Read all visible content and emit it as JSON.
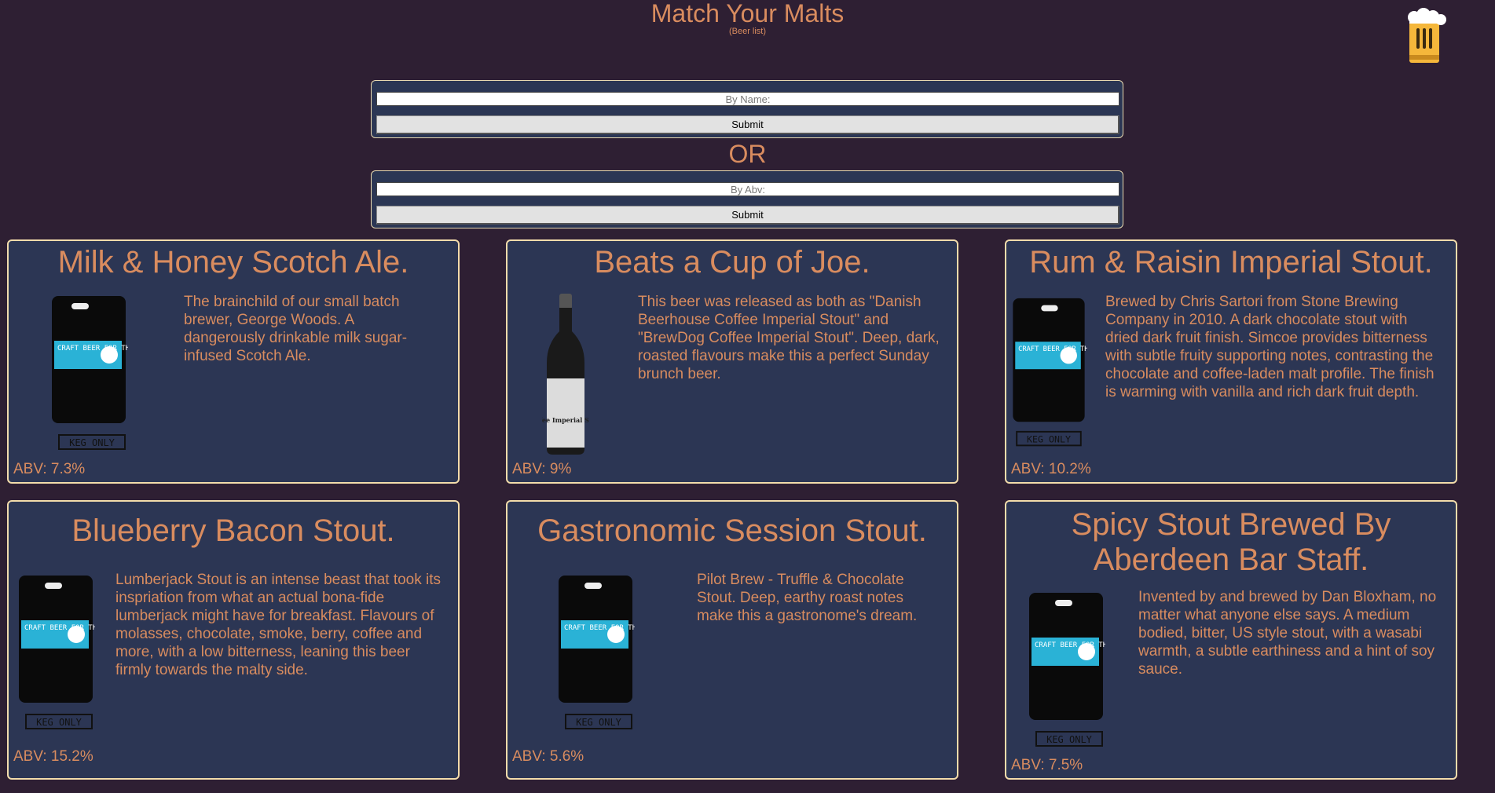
{
  "header": {
    "title": "Match Your Malts",
    "subtitle": "(Beer list)",
    "logo_icon": "beer-mug-icon"
  },
  "search": {
    "name_placeholder": "By Name:",
    "abv_placeholder": "By Abv:",
    "submit_label": "Submit",
    "or_label": "OR"
  },
  "colors": {
    "background": "#2e1f33",
    "card": "#2c3654",
    "card_border": "#f3dcab",
    "text": "#d98c5f",
    "label_blue": "#2ab2d6",
    "mug_yellow": "#f5b73b"
  },
  "beers": [
    {
      "name": "Milk & Honey Scotch Ale.",
      "description": "The brainchild of our small batch brewer, George Woods. A dangerously drinkable milk sugar-infused Scotch Ale.",
      "abv": "ABV: 7.3%",
      "image": "keg",
      "keg_label": "CRAFT BEER FOR THE PEOPLE",
      "keg_footer": "KEG ONLY"
    },
    {
      "name": "Beats a Cup of Joe.",
      "description": "This beer was released as both as \"Danish Beerhouse Coffee Imperial Stout\" and \"BrewDog Coffee Imperial Stout\". Deep, dark, roasted flavours make this a perfect Sunday brunch beer.",
      "abv": "ABV: 9%",
      "image": "bottle",
      "bottle_label": "Coffee Imperial Stout"
    },
    {
      "name": "Rum & Raisin Imperial Stout.",
      "description": "Brewed by Chris Sartori from Stone Brewing Company in 2010. A dark chocolate stout with dried dark fruit finish. Simcoe provides bitterness with subtle fruity supporting notes, contrasting the chocolate and coffee-laden malt profile. The finish is warming with vanilla and rich dark fruit depth.",
      "abv": "ABV: 10.2%",
      "image": "keg",
      "keg_label": "CRAFT BEER FOR THE PEOPLE",
      "keg_footer": "KEG ONLY"
    },
    {
      "name": "Blueberry Bacon Stout.",
      "description": "Lumberjack Stout is an intense beast that took its inspriation from what an actual bona-fide lumberjack might have for breakfast. Flavours of molasses, chocolate, smoke, berry, coffee and more, with a low bitterness, leaning this beer firmly towards the malty side.",
      "abv": "ABV: 15.2%",
      "image": "keg",
      "keg_label": "CRAFT BEER FOR THE PEOPLE",
      "keg_footer": "KEG ONLY"
    },
    {
      "name": "Gastronomic Session Stout.",
      "description": "Pilot Brew - Truffle & Chocolate Stout. Deep, earthy roast notes make this a gastronome's dream.",
      "abv": "ABV: 5.6%",
      "image": "keg",
      "keg_label": "CRAFT BEER FOR THE PEOPLE",
      "keg_footer": "KEG ONLY"
    },
    {
      "name": "Spicy Stout Brewed By Aberdeen Bar Staff.",
      "description": "Invented by and brewed by Dan Bloxham, no matter what anyone else says. A medium bodied, bitter, US style stout, with a wasabi warmth, a subtle earthiness and a hint of soy sauce.",
      "abv": "ABV: 7.5%",
      "image": "keg",
      "keg_label": "CRAFT BEER FOR THE PEOPLE",
      "keg_footer": "KEG ONLY"
    }
  ]
}
